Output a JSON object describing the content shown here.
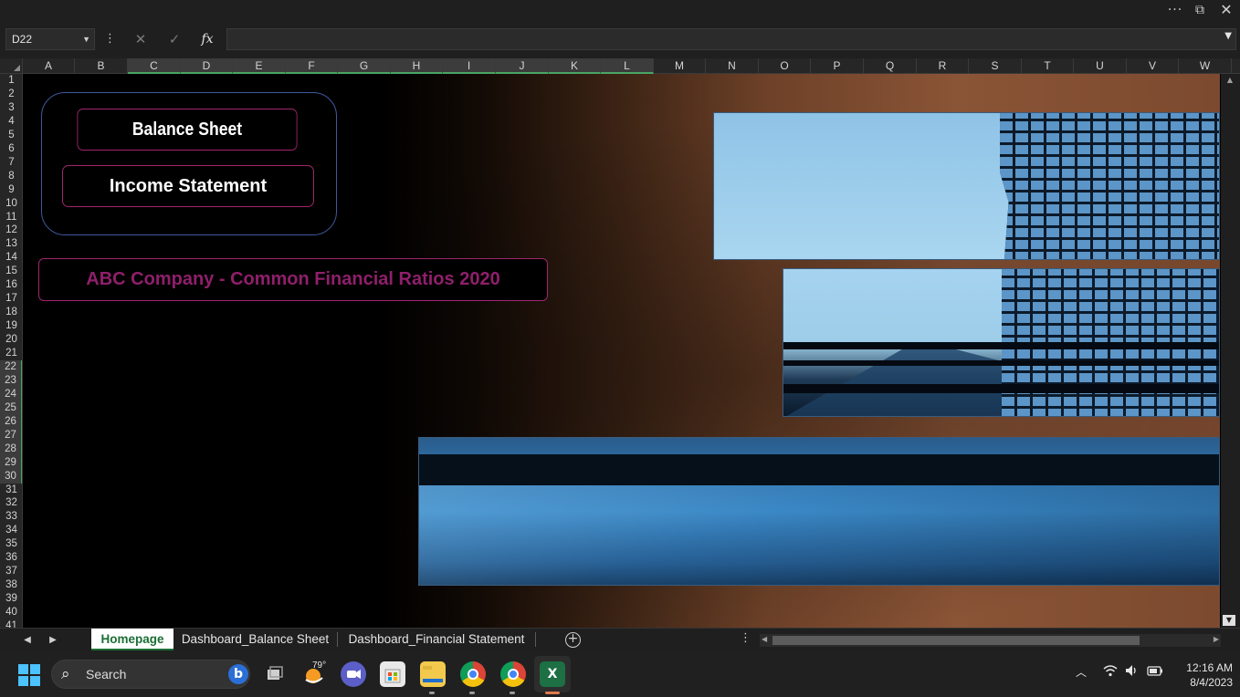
{
  "window": {
    "more_label": "···",
    "restore_label": "⧉",
    "close_label": "✕"
  },
  "formula_bar": {
    "name_box": "D22",
    "dots": "⋮",
    "cancel_icon": "✕",
    "enter_icon": "✓",
    "fx_label": "fx",
    "formula": ""
  },
  "columns": [
    "A",
    "B",
    "C",
    "D",
    "E",
    "F",
    "G",
    "H",
    "I",
    "J",
    "K",
    "L",
    "M",
    "N",
    "O",
    "P",
    "Q",
    "R",
    "S",
    "T",
    "U",
    "V",
    "W"
  ],
  "selected_columns": [
    "C",
    "D",
    "E",
    "F",
    "G",
    "H",
    "I",
    "J",
    "K",
    "L"
  ],
  "rows": [
    "1",
    "2",
    "3",
    "4",
    "5",
    "6",
    "7",
    "8",
    "9",
    "10",
    "11",
    "12",
    "13",
    "14",
    "15",
    "16",
    "17",
    "18",
    "19",
    "20",
    "21",
    "22",
    "23",
    "24",
    "25",
    "26",
    "27",
    "28",
    "29",
    "30",
    "31",
    "32",
    "33",
    "34",
    "35",
    "36",
    "37",
    "38",
    "39",
    "40",
    "41"
  ],
  "selected_rows": [
    "22",
    "23",
    "24",
    "25",
    "26",
    "27",
    "28",
    "29",
    "30"
  ],
  "dashboard": {
    "nav_buttons": {
      "balance_sheet": "Balance Sheet",
      "income_statement": "Income Statement"
    },
    "title": "ABC Company - Common Financial Ratios 2020",
    "title_color": "#8f1f6b",
    "button_border_color": "#a0266e",
    "group_border_color": "#3d5a9e"
  },
  "sheet_tabs": {
    "tabs": [
      "Homepage",
      "Dashboard_Balance Sheet",
      "Dashboard_Financial Statement"
    ],
    "active": "Homepage",
    "add_label": "+",
    "options": "⋮"
  },
  "taskbar": {
    "search_placeholder": "Search",
    "bing_label": "b",
    "weather_temp": "79°",
    "excel_label": "X",
    "clock_time": "12:16 AM",
    "clock_date": "8/4/2023"
  }
}
